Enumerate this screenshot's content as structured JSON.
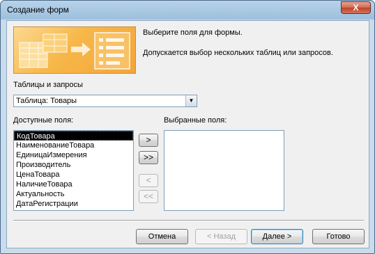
{
  "window": {
    "title": "Создание форм",
    "close_label": "X"
  },
  "header": {
    "instruction": "Выберите поля для формы.",
    "hint": "Допускается выбор нескольких таблиц или запросов."
  },
  "tables": {
    "label": "Таблицы и запросы",
    "selected": "Таблица: Товары"
  },
  "available": {
    "label": "Доступные поля:",
    "items": [
      "КодТовара",
      "НаименованиеТовара",
      "ЕдиницаИзмерения",
      "Производитель",
      "ЦенаТовара",
      "НаличиеТовара",
      "Актуальность",
      "ДатаРегистрации"
    ]
  },
  "selected_fields": {
    "label": "Выбранные поля:"
  },
  "move_buttons": {
    "add_one": ">",
    "add_all": ">>",
    "remove_one": "<",
    "remove_all": "<<"
  },
  "footer": {
    "cancel": "Отмена",
    "back": "< Назад",
    "next": "Далее >",
    "finish": "Готово"
  },
  "colors": {
    "banner": "#f7b749",
    "selection": "#000000",
    "default_button_border": "#3c7fb1"
  }
}
